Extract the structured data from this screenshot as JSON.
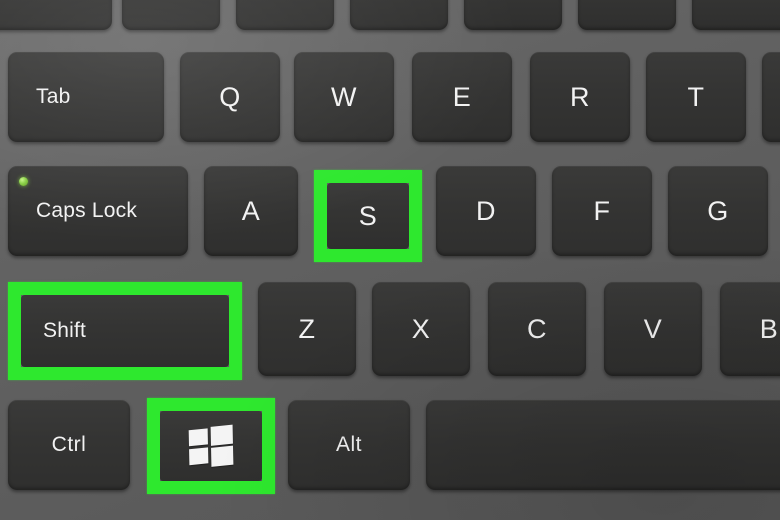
{
  "scene": {
    "title": "Laptop keyboard close-up with Windows + Shift + S shortcut highlighted",
    "background_color": "#5e5e5e",
    "key_face_color": "#343433",
    "key_label_color": "#f2f2f2",
    "highlight_color": "#2ee82e",
    "caps_lock_led_color": "#8ed44a",
    "highlighted_keys": [
      "Shift",
      "S",
      "Windows"
    ],
    "shortcut": "Windows + Shift + S"
  },
  "rows": {
    "row_numbers_partial": [
      {
        "label": "",
        "glyph": ""
      },
      {
        "label": "",
        "glyph": ""
      },
      {
        "label": "",
        "glyph": ""
      },
      {
        "label": "",
        "glyph": ""
      },
      {
        "label": "",
        "glyph": ""
      },
      {
        "label": "",
        "glyph": ""
      },
      {
        "label": "",
        "glyph": ""
      }
    ],
    "row_tab": [
      {
        "label": "Tab"
      },
      {
        "label": "Q"
      },
      {
        "label": "W"
      },
      {
        "label": "E"
      },
      {
        "label": "R"
      },
      {
        "label": "T"
      },
      {
        "label": ""
      }
    ],
    "row_home": [
      {
        "label": "Caps Lock"
      },
      {
        "label": "A"
      },
      {
        "label": "S"
      },
      {
        "label": "D"
      },
      {
        "label": "F"
      },
      {
        "label": "G"
      }
    ],
    "row_shift": [
      {
        "label": "Shift"
      },
      {
        "label": "Z"
      },
      {
        "label": "X"
      },
      {
        "label": "C"
      },
      {
        "label": "V"
      },
      {
        "label": "B"
      }
    ],
    "row_bottom": [
      {
        "label": "Ctrl"
      },
      {
        "label": "",
        "icon": "windows-logo-icon"
      },
      {
        "label": "Alt"
      },
      {
        "label": "",
        "icon": "spacebar"
      }
    ]
  },
  "icons": {
    "windows_logo": "windows-logo-icon",
    "caps_lock_led": "caps-lock-led-icon"
  }
}
